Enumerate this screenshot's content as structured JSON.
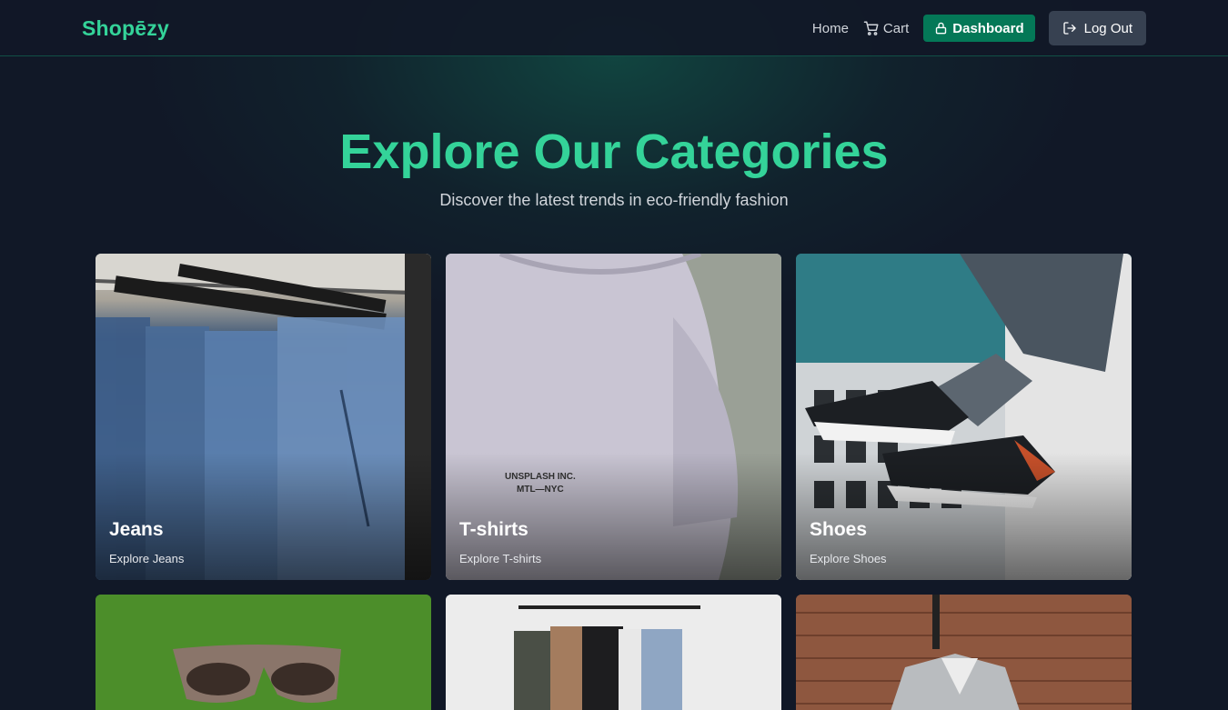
{
  "header": {
    "brand": "Shopēzy",
    "nav": {
      "home": "Home",
      "cart": "Cart",
      "dashboard": "Dashboard",
      "logout": "Log Out"
    }
  },
  "hero": {
    "title": "Explore Our Categories",
    "subtitle": "Discover the latest trends in eco-friendly fashion"
  },
  "categories": [
    {
      "name": "Jeans",
      "link": "Explore Jeans"
    },
    {
      "name": "T-shirts",
      "link": "Explore T-shirts"
    },
    {
      "name": "Shoes",
      "link": "Explore Shoes"
    }
  ],
  "colors": {
    "accent": "#34d399",
    "dashboard_button": "#047857",
    "background": "#111827"
  }
}
